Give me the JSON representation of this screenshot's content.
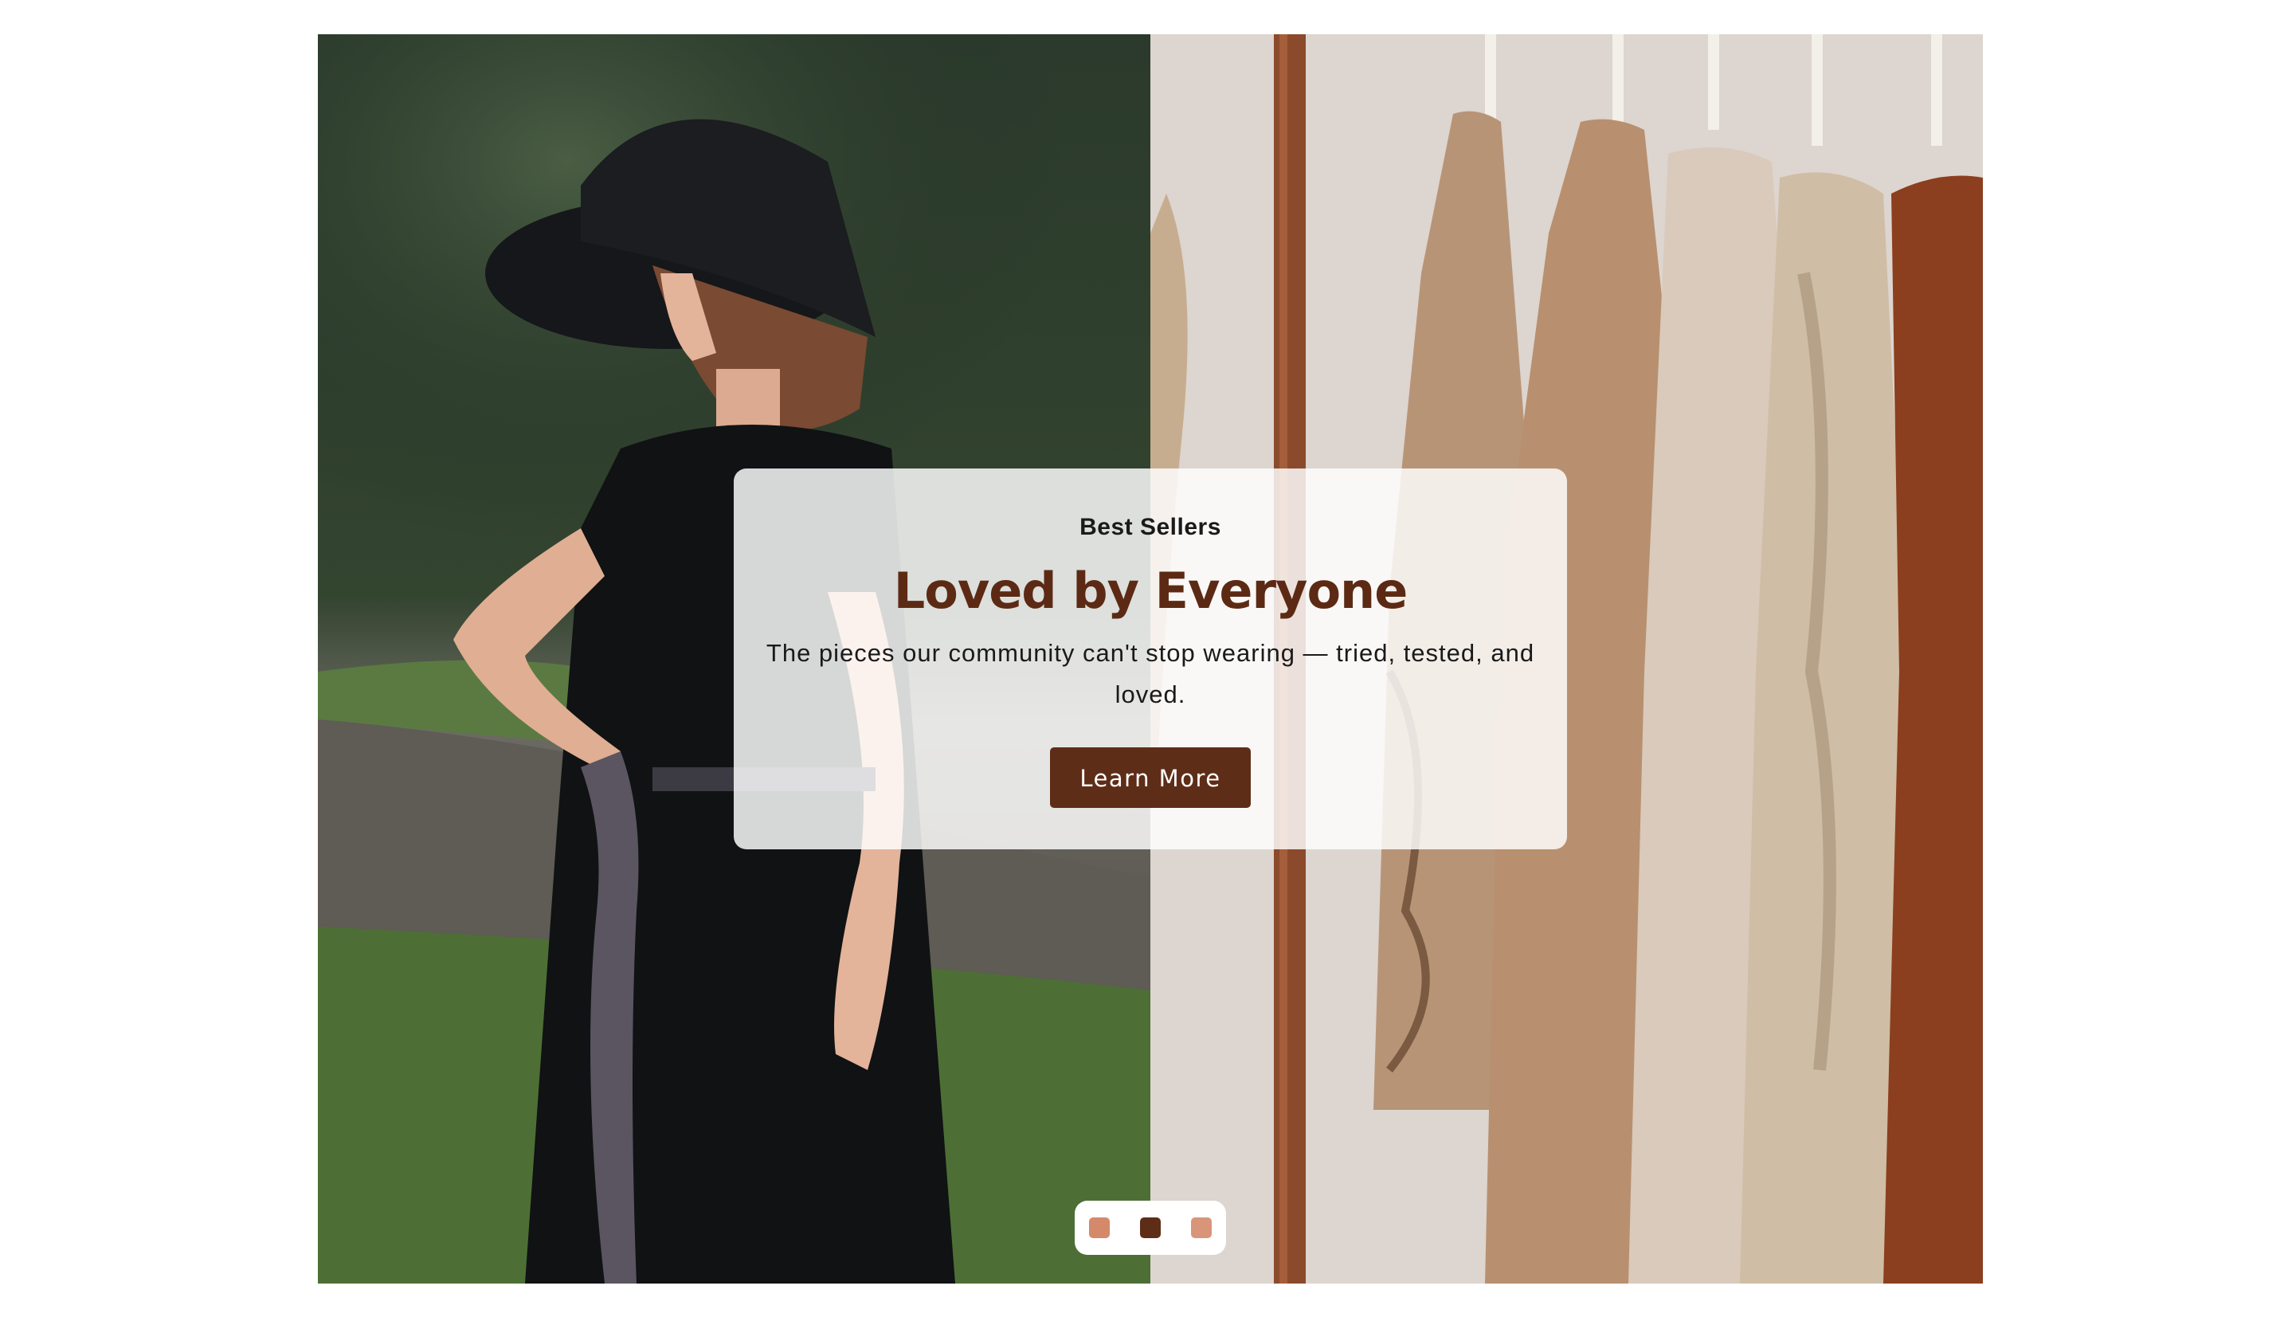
{
  "slide": {
    "eyebrow": "Best Sellers",
    "headline": "Loved by Everyone",
    "subtext": "The pieces our community can't stop wearing — tried, tested, and loved.",
    "cta_label": "Learn More"
  },
  "carousel": {
    "active_index": 1,
    "dots": [
      {
        "color": "#d4896b",
        "active": false
      },
      {
        "color": "#5e2d17",
        "active": true
      },
      {
        "color": "#d9957a",
        "active": false
      }
    ]
  },
  "images": {
    "left": "woman-in-black-hat-photo",
    "right": "clothing-rack-photo"
  },
  "colors": {
    "headline": "#5c2a14",
    "button": "#5e2d17"
  }
}
